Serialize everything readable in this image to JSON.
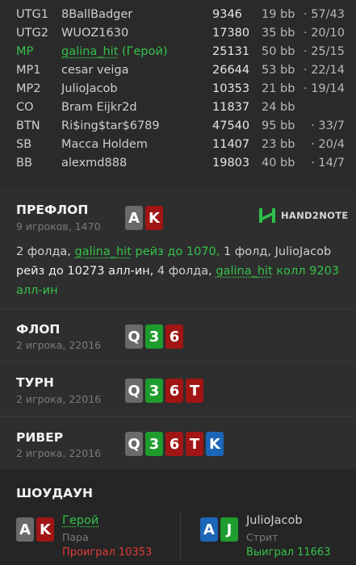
{
  "players": [
    {
      "pos": "UTG1",
      "name": "8BallBadger",
      "stack": "9346",
      "bb": "19 bb",
      "stats": "· 57/43"
    },
    {
      "pos": "UTG2",
      "name": "WUOZ1630",
      "stack": "17380",
      "bb": "35 bb",
      "stats": "· 20/10"
    },
    {
      "pos": "MP",
      "name": "galina_hit",
      "hero_tag": "(Герой)",
      "stack": "25131",
      "bb": "50 bb",
      "stats": "· 25/15"
    },
    {
      "pos": "MP1",
      "name": "cesar veiga",
      "stack": "26644",
      "bb": "53 bb",
      "stats": "· 22/14"
    },
    {
      "pos": "MP2",
      "name": "JulioJacob",
      "stack": "10353",
      "bb": "21 bb",
      "stats": "· 19/14"
    },
    {
      "pos": "CO",
      "name": "Bram Eijkr2d",
      "stack": "11837",
      "bb": "24 bb",
      "stats": ""
    },
    {
      "pos": "BTN",
      "name": "Ri$ing$tar$6789",
      "stack": "47540",
      "bb": "95 bb",
      "stats": "· 33/7"
    },
    {
      "pos": "SB",
      "name": "Macca Holdem",
      "stack": "11407",
      "bb": "23 bb",
      "stats": "· 20/4"
    },
    {
      "pos": "BB",
      "name": "alexmd888",
      "stack": "19803",
      "bb": "40 bb",
      "stats": "· 14/7"
    }
  ],
  "preflop": {
    "title": "ПРЕФЛОП",
    "subtitle": "9 игроков, 1470",
    "cards": [
      {
        "rank": "A",
        "suit": "spades"
      },
      {
        "rank": "K",
        "suit": "hearts"
      }
    ],
    "action": {
      "t1": "2 фолда, ",
      "hero1": "galina_hit",
      "t2": " рейз до 1070, ",
      "t3": "1 фолд, JulioJacob ",
      "t4": "рейз до 10273 алл-ин, ",
      "t5": "4 фолда, ",
      "hero2": "galina_hit",
      "t6": " колл 9203 алл-ин"
    }
  },
  "logo": {
    "text": "HAND2NOTE",
    "icon": "hand2note-logo-icon"
  },
  "flop": {
    "title": "ФЛОП",
    "subtitle": "2 игрока, 22016",
    "cards": [
      {
        "rank": "Q",
        "suit": "spades"
      },
      {
        "rank": "3",
        "suit": "clubs"
      },
      {
        "rank": "6",
        "suit": "hearts"
      }
    ]
  },
  "turn": {
    "title": "ТУРН",
    "subtitle": "2 игрока, 22016",
    "cards": [
      {
        "rank": "Q",
        "suit": "spades"
      },
      {
        "rank": "3",
        "suit": "clubs"
      },
      {
        "rank": "6",
        "suit": "hearts"
      },
      {
        "rank": "T",
        "suit": "hearts"
      }
    ]
  },
  "river": {
    "title": "РИВЕР",
    "subtitle": "2 игрока, 22016",
    "cards": [
      {
        "rank": "Q",
        "suit": "spades"
      },
      {
        "rank": "3",
        "suit": "clubs"
      },
      {
        "rank": "6",
        "suit": "hearts"
      },
      {
        "rank": "T",
        "suit": "hearts"
      },
      {
        "rank": "K",
        "suit": "diamonds"
      }
    ]
  },
  "showdown": {
    "title": "ШОУДАУН",
    "left": {
      "name": "Герой",
      "hand": "Пара",
      "result": "Проиграл 10353",
      "cards": [
        {
          "rank": "A",
          "suit": "spades"
        },
        {
          "rank": "K",
          "suit": "hearts"
        }
      ]
    },
    "right": {
      "name": "JulioJacob",
      "hand": "Стрит",
      "result": "Выиграл 11663",
      "cards": [
        {
          "rank": "A",
          "suit": "diamonds"
        },
        {
          "rank": "J",
          "suit": "clubs"
        }
      ]
    }
  },
  "colors": {
    "hero_green": "#35c24a",
    "loss_red": "#e23a3a",
    "win_green": "#35c24a",
    "spades": "#6a6a6a",
    "hearts": "#a11515",
    "clubs": "#1e9c2e",
    "diamonds": "#1c66b8"
  }
}
